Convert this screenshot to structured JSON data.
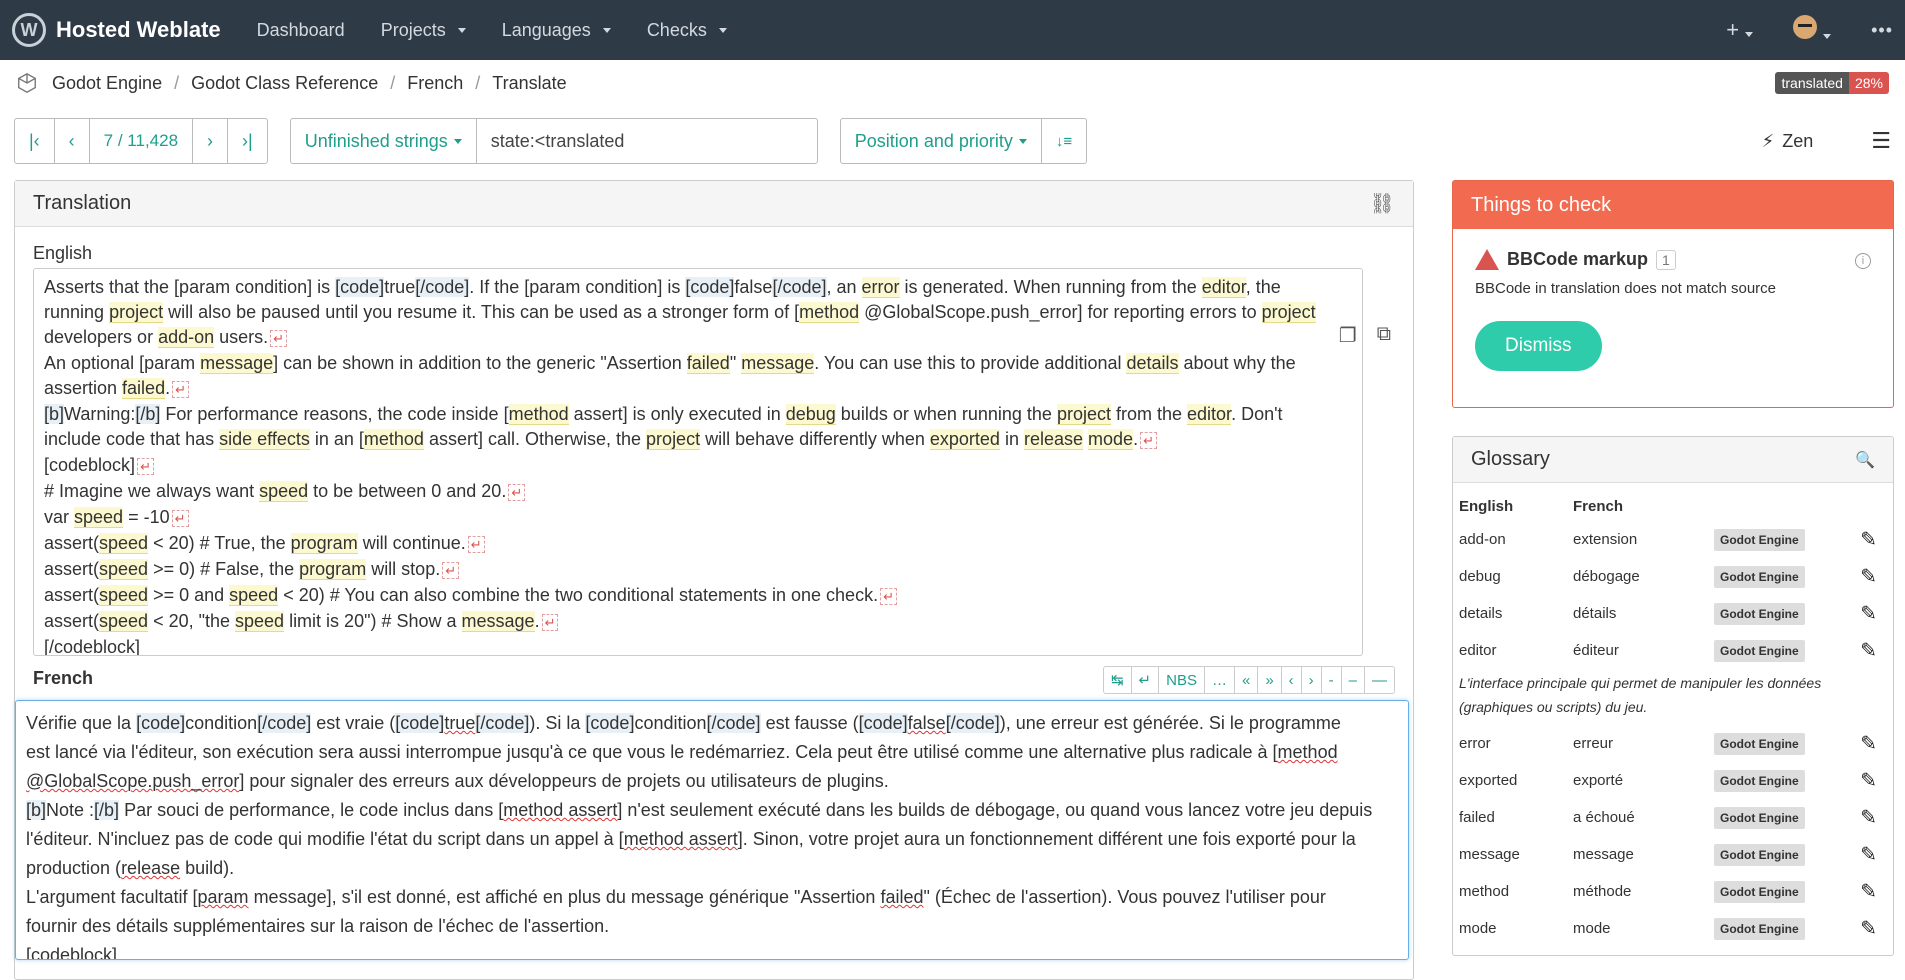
{
  "navbar": {
    "brand": "Hosted Weblate",
    "items": [
      "Dashboard",
      "Projects",
      "Languages",
      "Checks"
    ],
    "plus": "+",
    "more": "•••"
  },
  "breadcrumb": {
    "items": [
      "Godot Engine",
      "Godot Class Reference",
      "French",
      "Translate"
    ],
    "status_label": "translated",
    "status_pct": "28%"
  },
  "toolbar": {
    "position": "7 / 11,428",
    "filter_label": "Unfinished strings",
    "filter_query": "state:<translated",
    "sort_label": "Position and priority",
    "zen_label": "Zen"
  },
  "translation": {
    "panel_title": "Translation",
    "source_lang": "English",
    "target_lang": "French",
    "special_chars": [
      "↹",
      "↵",
      "NBS",
      "…",
      "«",
      "»",
      "‹",
      "›",
      "-",
      "–",
      "—"
    ]
  },
  "checks": {
    "title": "Things to check",
    "name": "BBCode markup",
    "count": "1",
    "description": "BBCode in translation does not match source",
    "dismiss": "Dismiss"
  },
  "glossary": {
    "title": "Glossary",
    "col_en": "English",
    "col_fr": "French",
    "rows": [
      {
        "en": "add-on",
        "fr": "extension",
        "tag": "Godot Engine"
      },
      {
        "en": "debug",
        "fr": "débogage",
        "tag": "Godot Engine"
      },
      {
        "en": "details",
        "fr": "détails",
        "tag": "Godot Engine"
      },
      {
        "en": "editor",
        "fr": "éditeur",
        "tag": "Godot Engine"
      },
      {
        "en": "error",
        "fr": "erreur",
        "tag": "Godot Engine"
      },
      {
        "en": "exported",
        "fr": "exporté",
        "tag": "Godot Engine"
      },
      {
        "en": "failed",
        "fr": "a échoué",
        "tag": "Godot Engine"
      },
      {
        "en": "message",
        "fr": "message",
        "tag": "Godot Engine"
      },
      {
        "en": "method",
        "fr": "méthode",
        "tag": "Godot Engine"
      },
      {
        "en": "mode",
        "fr": "mode",
        "tag": "Godot Engine"
      }
    ],
    "editor_note": "L'interface principale qui permet de manipuler les données (graphiques ou scripts) du jeu."
  },
  "source_text": {
    "l1a": "Asserts that the [param condition] is ",
    "l1_code1": "[code]",
    "l1_true": "true",
    "l1_code2": "[/code]",
    "l1b": ". If the [param condition] is ",
    "l1_code3": "[code]",
    "l1_false": "false",
    "l1_code4": "[/code]",
    "l1c": ", an ",
    "l1_error": "error",
    "l1d": " is generated. When running from the ",
    "l1_editor": "editor",
    "l1e": ", the",
    "l2a": "running ",
    "l2_project": "project",
    "l2b": " will also be paused until you resume it. This can be used as a stronger form of [",
    "l2_method": "method",
    "l2c": " @GlobalScope.push_error] for reporting errors to ",
    "l2_project2": "project",
    "l3a": "developers or ",
    "l3_addon": "add-on",
    "l3b": " users.",
    "l4a": "An optional [param ",
    "l4_message": "message",
    "l4b": "] can be shown in addition to the generic \"Assertion ",
    "l4_failed": "failed",
    "l4c": "\" ",
    "l4_message2": "message",
    "l4d": ". You can use this to provide additional ",
    "l4_details": "details",
    "l4e": " about why the",
    "l5a": "assertion ",
    "l5_failed": "failed",
    "l5b": ".",
    "l6_b1": "[b]",
    "l6a": "Warning:",
    "l6_b2": "[/b]",
    "l6b": " For performance reasons, the code inside [",
    "l6_method": "method",
    "l6c": " assert] is only executed in ",
    "l6_debug": "debug",
    "l6d": " builds or when running the ",
    "l6_project": "project",
    "l6e": " from the ",
    "l6_editor": "editor",
    "l6f": ". Don't",
    "l7a": "include code that has ",
    "l7_side": "side effects",
    "l7b": " in an [",
    "l7_method": "method",
    "l7c": " assert] call. Otherwise, the ",
    "l7_project": "project",
    "l7d": " will behave differently when ",
    "l7_exported": "exported",
    "l7e": " in ",
    "l7_release": "release",
    "l7f": " ",
    "l7_mode": "mode",
    "l7g": ".",
    "l8": "[codeblock]",
    "l9a": "# Imagine we always want ",
    "l9_speed": "speed",
    "l9b": " to be between 0 and 20.",
    "l10a": "var ",
    "l10_speed": "speed",
    "l10b": " = -10",
    "l11a": "assert(",
    "l11_speed": "speed",
    "l11b": " < 20) # True, the ",
    "l11_program": "program",
    "l11c": " will continue.",
    "l12a": "assert(",
    "l12_speed": "speed",
    "l12b": " >= 0) # False, the ",
    "l12_program": "program",
    "l12c": " will stop.",
    "l13a": "assert(",
    "l13_speed": "speed",
    "l13b": " >= 0 and ",
    "l13_speed2": "speed",
    "l13c": " < 20) # You can also combine the two conditional statements in one check.",
    "l14a": "assert(",
    "l14_speed": "speed",
    "l14b": " < 20, \"the ",
    "l14_speed2": "speed",
    "l14c": " limit is 20\") # Show a ",
    "l14_message": "message",
    "l14d": ".",
    "l15": "[/codeblock]",
    "nl": "↵"
  },
  "target_text": {
    "t1a": "Vérifie que la ",
    "t1_c1": "[code]",
    "t1b": "condition",
    "t1_c2": "[/code]",
    "t1c": " est vraie (",
    "t1_c3": "[code]",
    "t1_true": "true",
    "t1_c4": "[/code]",
    "t1d": "). Si la ",
    "t1_c5": "[code]",
    "t1e": "condition",
    "t1_c6": "[/code]",
    "t1f": " est fausse (",
    "t1_c7": "[code]",
    "t1_false": "false",
    "t1_c8": "[/code]",
    "t1g": "), une erreur est générée. Si le programme",
    "t2": "est lancé via l'éditeur, son exécution sera aussi interrompue jusqu'à ce que vous le redémarriez. Cela peut être utilisé comme une alternative plus radicale à [",
    "t2_method": "method",
    "t3_a": "@GlobalScope.push_error",
    "t3b": "] pour signaler des erreurs aux développeurs de projets ou utilisateurs de plugins.",
    "t4_b1": "[b]",
    "t4a": "Note :",
    "t4_b2": "[/b]",
    "t4b": " Par souci de performance, le code inclus dans [",
    "t4_ma": "method assert",
    "t4c": "] n'est seulement exécuté dans les builds de débogage, ou quand vous lancez votre jeu depuis",
    "t5a": "l'éditeur. N'incluez pas de code qui modifie l'état du script dans un appel à [",
    "t5_ma": "method assert",
    "t5b": "]. Sinon, votre projet aura un fonctionnement différent une fois exporté pour la",
    "t6a": "production (",
    "t6_release": "release",
    "t6b": " build).",
    "t7a": "L'argument facultatif [",
    "t7_param": "param",
    "t7b": " message]",
    "t7c": ", s'il est donné, est affiché en plus du message générique \"Assertion ",
    "t7_failed": "failed",
    "t7d": "\" (Échec de l'assertion). Vous pouvez l'utiliser pour",
    "t8": "fournir des détails supplémentaires sur la raison de l'échec de l'assertion.",
    "t9": "[codeblock]"
  }
}
